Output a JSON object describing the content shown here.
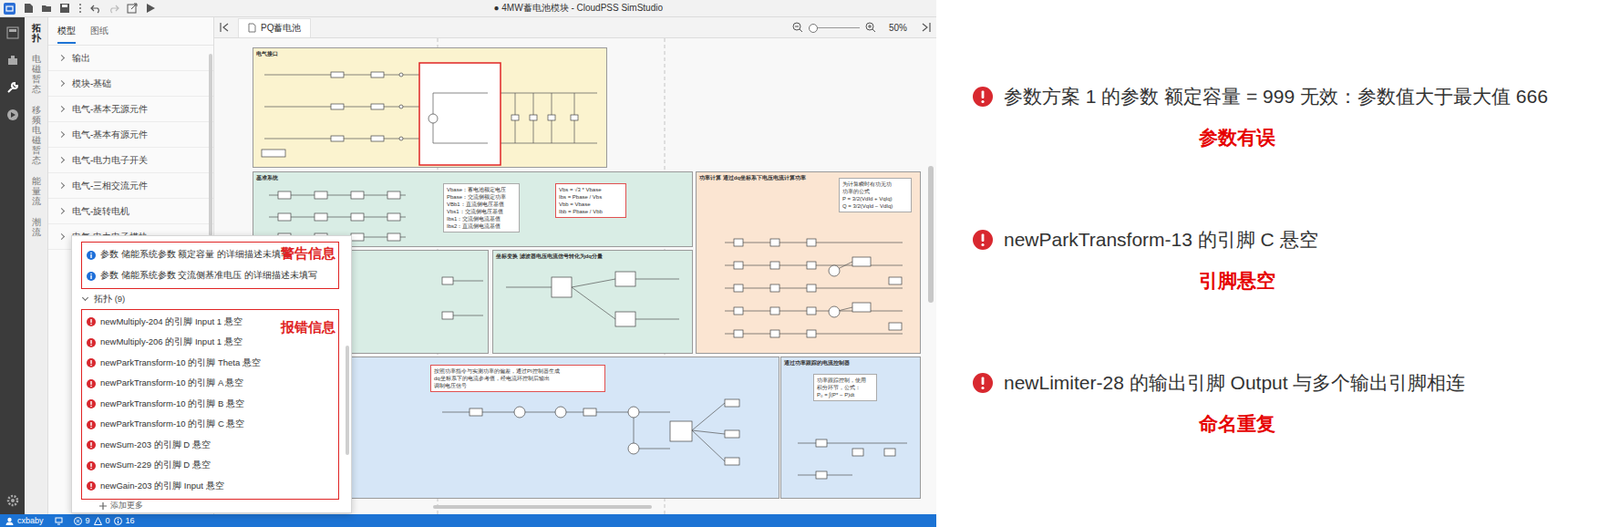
{
  "window": {
    "title": "● 4MW蓄电池模块 - CloudPSS SimStudio"
  },
  "side_tabs": [
    {
      "label": "拓扑",
      "selected": true
    },
    {
      "label": "电磁暂态",
      "selected": false
    },
    {
      "label": "移频电磁暂态",
      "selected": false
    },
    {
      "label": "能量流",
      "selected": false
    },
    {
      "label": "潮流",
      "selected": false
    }
  ],
  "panel_tabs": [
    {
      "label": "模型",
      "selected": true
    },
    {
      "label": "图纸",
      "selected": false
    }
  ],
  "categories": [
    "输出",
    "模块-基础",
    "电气-基本无源元件",
    "电气-基本有源元件",
    "电气-电力电子开关",
    "电气-三相交流元件",
    "电气-旋转电机",
    "电气-电力电子模块"
  ],
  "editor": {
    "tab": "PQ蓄电池",
    "zoom": "50%"
  },
  "diagram": {
    "blocks": [
      {
        "title": "电气接口",
        "color": "#fbf3cf",
        "notes": []
      },
      {
        "title": "基准系统",
        "color": "#d9ede5",
        "notes": [
          {
            "kind": "plain",
            "lines": [
              "Vbase：蓄电池额定电压",
              "Pbase：交流侧额定功率",
              "VBb1：直流侧电压基值",
              "Vbs1：交流侧电压基值",
              "Ibs1：交流侧电流基值",
              "Ibs2：直流侧电流基值"
            ]
          },
          {
            "kind": "highlighted",
            "lines": [
              "Vbs = √3 * Vbase",
              "Ibs = Pbase / Vbs",
              "Vbb = Vbase",
              "Ibb = Pbase / Vbb"
            ]
          }
        ]
      },
      {
        "title": "功率计算 通过dq坐标系下电压电流计算功率",
        "color": "#fbe5d2",
        "notes": [
          {
            "kind": "plain",
            "lines": [
              "为计算瞬时有功无功",
              "功率的公式",
              "P = 3/2(VdId + VqIq)",
              "Q = 3/2(VqId − VdIq)"
            ]
          }
        ]
      },
      {
        "color": "#d9ede5",
        "notes": []
      },
      {
        "title": "坐标变换 滤波器电压电流信号转化为dq分量",
        "color": "#d9ede5",
        "notes": []
      },
      {
        "color": "#d6e6f7",
        "notes": [
          {
            "kind": "highlighted",
            "lines": [
              "按照功率指令与实测功率的偏差，通过PI控制器生成",
              "dq坐标系下的电流参考值，经电流环控制后输出",
              "调制电压信号"
            ]
          }
        ]
      },
      {
        "title": "通过功率跟踪的电流控制器",
        "color": "#d6e6f7",
        "notes": [
          {
            "kind": "plain",
            "lines": [
              "功率跟踪控制，使用",
              "积分环节，公式：",
              "P₀ = ∫(P* − P)dt"
            ]
          }
        ]
      }
    ]
  },
  "problems": {
    "warnings": [
      "参数 储能系统参数 额定容量 的详细描述未填写",
      "参数 储能系统参数 交流侧基准电压 的详细描述未填写"
    ],
    "warning_label": "警告信息",
    "group": {
      "label": "拓扑 (9)",
      "expanded": true
    },
    "errors": [
      "newMultiply-204 的引脚 Input 1 悬空",
      "newMultiply-206 的引脚 Input 1 悬空",
      "newParkTransform-10 的引脚 Theta 悬空",
      "newParkTransform-10 的引脚 A 悬空",
      "newParkTransform-10 的引脚 B 悬空",
      "newParkTransform-10 的引脚 C 悬空",
      "newSum-203 的引脚 D 悬空",
      "newSum-229 的引脚 D 悬空",
      "newGain-203 的引脚 Input 悬空"
    ],
    "error_label": "报错信息",
    "footer": "添加更多"
  },
  "status_bar": {
    "user": "cxbaby",
    "errors": "9",
    "warnings": "0",
    "infos": "16"
  },
  "annotations": [
    {
      "message": "参数方案 1 的参数 额定容量 = 999 无效：参数值大于最大值 666",
      "label": "参数有误"
    },
    {
      "message": "newParkTransform-13 的引脚 C 悬空",
      "label": "引脚悬空"
    },
    {
      "message": "newLimiter-28 的输出引脚 Output 与多个输出引脚相连",
      "label": "命名重复"
    }
  ]
}
